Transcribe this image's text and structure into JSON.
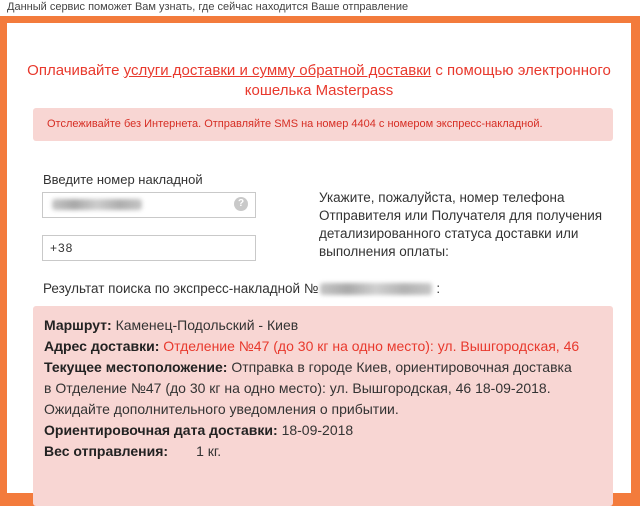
{
  "header": {
    "tagline": "Данный сервис поможет Вам узнать, где сейчас находится Ваше отправление"
  },
  "promo": {
    "prefix": "Оплачивайте ",
    "link_text": "услуги доставки и сумму обратной доставки",
    "suffix": " с помощью электронного",
    "line2": "кошелька Masterpass"
  },
  "sms_notice": "Отслеживайте без Интернета. Отправляйте SMS на номер 4404 с номером экспресс-накладной.",
  "form": {
    "invoice_label": "Введите номер накладной",
    "phone_value": "+38",
    "help_glyph": "?",
    "phone_note": "Укажите, пожалуйста, номер телефона Отправителя или Получателя для получения детализированного статуса доставки или выполнения оплаты:"
  },
  "result": {
    "title_prefix": "Результат поиска по экспресс-накладной №",
    "title_suffix": ":",
    "route_label": "Маршрут:",
    "route_value": " Каменец-Подольский - Киев",
    "address_label": "Адрес доставки:",
    "address_value": " Отделение №47 (до 30 кг на одно место): ул. Вышгородская, 46",
    "location_label": "Текущее местоположение:",
    "location_value_1": " Отправка в городе Киев, ориентировочная доставка",
    "location_value_2": "в Отделение №47 (до 30 кг на одно место): ул. Вышгородская, 46 18-09-2018.",
    "location_value_3": "Ожидайте дополнительного уведомления о прибытии.",
    "date_label": "Ориентировочная дата доставки:",
    "date_value": " 18-09-2018",
    "weight_label": "Вес отправления:",
    "weight_value": "1 кг."
  },
  "colors": {
    "page_background": "#f37b3c",
    "accent_red": "#e8392d",
    "notice_background": "#f8d6d3"
  }
}
